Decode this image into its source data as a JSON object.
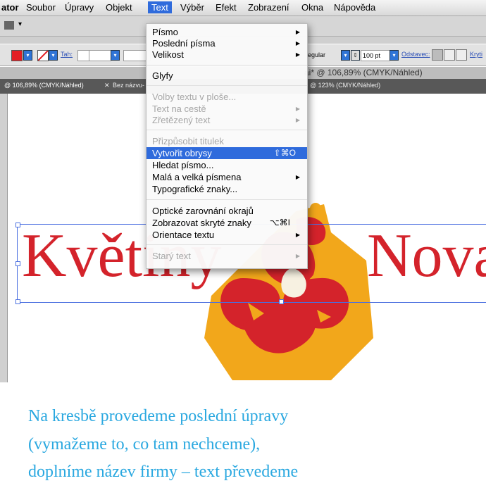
{
  "menubar": {
    "items": [
      "ator",
      "Soubor",
      "Úpravy",
      "Objekt",
      "Text",
      "Výběr",
      "Efekt",
      "Zobrazení",
      "Okna",
      "Nápověda"
    ]
  },
  "toolbar": {
    "stroke_label": "Tah:",
    "font_style": "egular",
    "font_size": "100 pt",
    "paragraph_label": "Odstavec:",
    "extra_label": "Kryti"
  },
  "docbar": {
    "title": "ai* @ 106,89% (CMYK/Náhled)"
  },
  "tabs": [
    "@ 106,89% (CMYK/Náhled)",
    "Bez názvu-",
    "@ 123% (CMYK/Náhled)"
  ],
  "text_menu": {
    "items": [
      {
        "label": "Písmo",
        "submenu": true,
        "disabled": false
      },
      {
        "label": "Poslední písma",
        "submenu": true,
        "disabled": false
      },
      {
        "label": "Velikost",
        "submenu": true,
        "disabled": false
      },
      {
        "label": "Glyfy",
        "submenu": false,
        "disabled": false
      },
      {
        "label": "Volby textu v ploše...",
        "submenu": false,
        "disabled": true
      },
      {
        "label": "Text na cestě",
        "submenu": true,
        "disabled": true
      },
      {
        "label": "Zřetězený text",
        "submenu": true,
        "disabled": true
      },
      {
        "label": "Přizpůsobit titulek",
        "submenu": false,
        "disabled": true
      },
      {
        "label": "Vytvořit obrysy",
        "shortcut": "⇧⌘O",
        "submenu": false,
        "disabled": false,
        "highlighted": true
      },
      {
        "label": "Hledat písmo...",
        "submenu": false,
        "disabled": false
      },
      {
        "label": "Malá a velká písmena",
        "submenu": true,
        "disabled": false
      },
      {
        "label": "Typografické znaky...",
        "submenu": false,
        "disabled": false
      },
      {
        "label": "Optické zarovnání okrajů",
        "submenu": false,
        "disabled": false
      },
      {
        "label": "Zobrazovat skryté znaky",
        "shortcut": "⌥⌘I",
        "submenu": false,
        "disabled": false
      },
      {
        "label": "Orientace textu",
        "submenu": true,
        "disabled": false
      },
      {
        "label": "Starý text",
        "submenu": true,
        "disabled": true
      }
    ]
  },
  "artwork": {
    "text_left": "Květiny",
    "text_right": "Nova"
  },
  "caption": {
    "lines": [
      "Na kresbě provedeme poslední úpravy",
      "(vymažeme to, co tam nechceme),",
      "doplníme název firmy – text převedeme"
    ]
  },
  "colors": {
    "accent": "#2f6bdc",
    "text_red": "#d4232b",
    "flower_orange": "#f2a71b",
    "caption_blue": "#2aa8e0"
  }
}
